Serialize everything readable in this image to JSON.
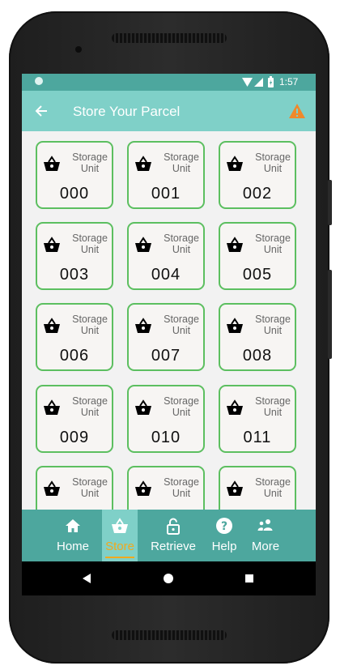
{
  "status_bar": {
    "time": "1:57"
  },
  "app_bar": {
    "title": "Store Your Parcel",
    "back_icon": "arrow-back-icon",
    "warning_icon": "warning-icon",
    "warning_color": "#f0892b"
  },
  "units": [
    {
      "label": "Storage Unit",
      "number": "000"
    },
    {
      "label": "Storage Unit",
      "number": "001"
    },
    {
      "label": "Storage Unit",
      "number": "002"
    },
    {
      "label": "Storage Unit",
      "number": "003"
    },
    {
      "label": "Storage Unit",
      "number": "004"
    },
    {
      "label": "Storage Unit",
      "number": "005"
    },
    {
      "label": "Storage Unit",
      "number": "006"
    },
    {
      "label": "Storage Unit",
      "number": "007"
    },
    {
      "label": "Storage Unit",
      "number": "008"
    },
    {
      "label": "Storage Unit",
      "number": "009"
    },
    {
      "label": "Storage Unit",
      "number": "010"
    },
    {
      "label": "Storage Unit",
      "number": "011"
    },
    {
      "label": "Storage Unit",
      "number": ""
    },
    {
      "label": "Storage Unit",
      "number": ""
    },
    {
      "label": "Storage Unit",
      "number": ""
    }
  ],
  "bottom_nav": [
    {
      "label": "Home",
      "icon": "home-icon"
    },
    {
      "label": "Store",
      "icon": "basket-icon",
      "active": true
    },
    {
      "label": "Retrieve",
      "icon": "unlock-icon"
    },
    {
      "label": "Help",
      "icon": "help-icon"
    },
    {
      "label": "More",
      "icon": "people-icon"
    }
  ],
  "colors": {
    "accent": "#7fd0c8",
    "accent_dark": "#4da79e",
    "unit_border": "#5cbf60",
    "active_label": "#f0a91e"
  }
}
